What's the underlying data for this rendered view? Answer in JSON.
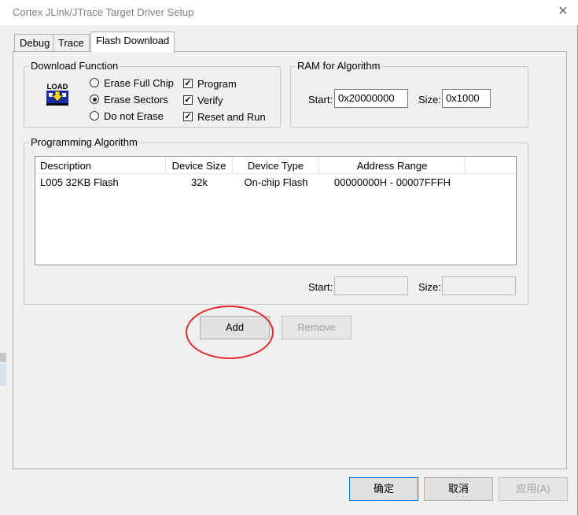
{
  "window": {
    "title": "Cortex JLink/JTrace Target Driver Setup",
    "close_glyph": "✕"
  },
  "tabs": [
    {
      "label": "Debug"
    },
    {
      "label": "Trace"
    },
    {
      "label": "Flash Download"
    }
  ],
  "download_function": {
    "label": "Download Function",
    "icon_text": "LOAD",
    "erase_options": [
      {
        "label": "Erase Full Chip",
        "selected": false
      },
      {
        "label": "Erase Sectors",
        "selected": true
      },
      {
        "label": "Do not Erase",
        "selected": false
      }
    ],
    "checks": [
      {
        "label": "Program",
        "checked": true
      },
      {
        "label": "Verify",
        "checked": true
      },
      {
        "label": "Reset and Run",
        "checked": true
      }
    ]
  },
  "ram_for_algorithm": {
    "label": "RAM for Algorithm",
    "start_label": "Start:",
    "start_value": "0x20000000",
    "size_label": "Size:",
    "size_value": "0x1000"
  },
  "programming_algorithm": {
    "label": "Programming Algorithm",
    "columns": [
      "Description",
      "Device Size",
      "Device Type",
      "Address Range"
    ],
    "rows": [
      {
        "description": "L005 32KB Flash",
        "device_size": "32k",
        "device_type": "On-chip Flash",
        "address_range": "00000000H - 00007FFFH"
      }
    ],
    "start_label": "Start:",
    "start_value": "",
    "size_label": "Size:",
    "size_value": ""
  },
  "actions": {
    "add": "Add",
    "remove": "Remove"
  },
  "dialog_buttons": {
    "ok": "确定",
    "cancel": "取消",
    "apply": "应用(A)"
  },
  "colors": {
    "highlight_ring": "#e02a2a",
    "default_button_border": "#0078d7"
  }
}
